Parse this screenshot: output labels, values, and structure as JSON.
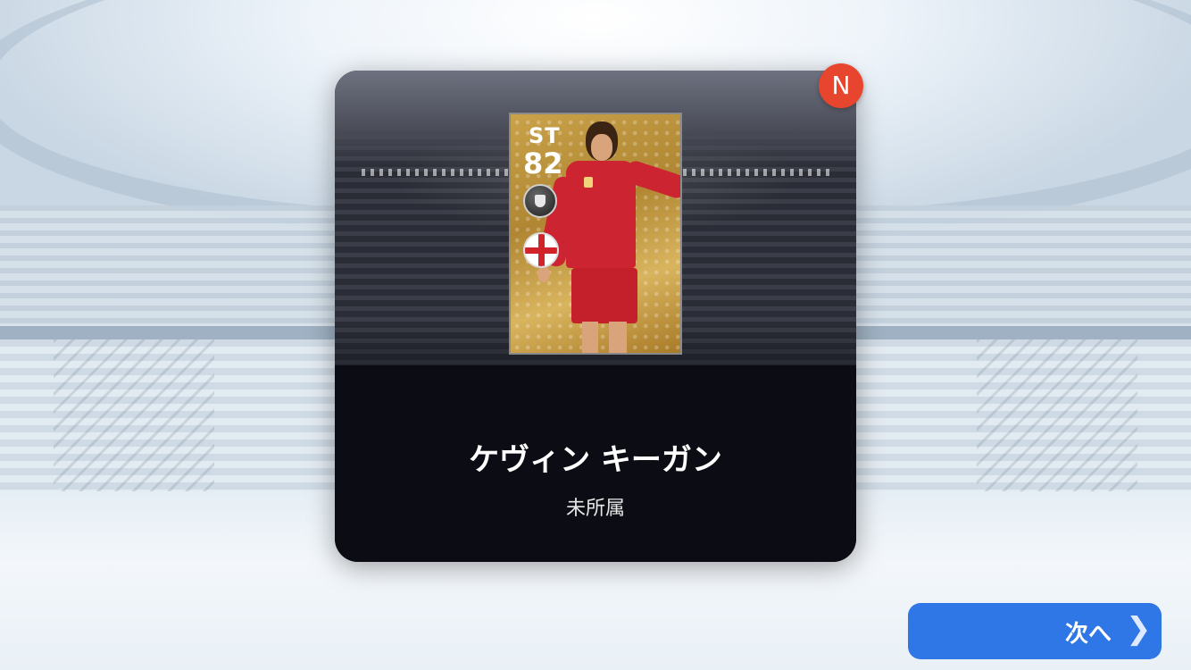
{
  "badge": {
    "label": "N",
    "color": "#e8452f"
  },
  "player": {
    "position": "ST",
    "rating": "82",
    "name": "ケヴィン キーガン",
    "club": "未所属",
    "club_icon": "club-crest-icon",
    "nationality_icon": "england-flag-icon"
  },
  "actions": {
    "next_label": "次へ",
    "next_icon": "chevron-right-icon",
    "accent_color": "#2f76e6"
  }
}
